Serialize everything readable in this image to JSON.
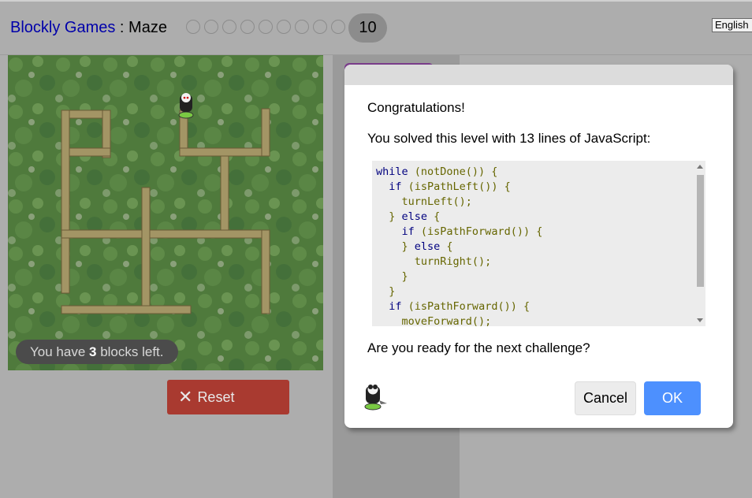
{
  "header": {
    "brand": "Blockly Games",
    "separator": " : ",
    "app": "Maze",
    "level_count": 9,
    "current_level": "10",
    "language": "English"
  },
  "maze": {
    "capacity_prefix": "You have ",
    "capacity_count": "3",
    "capacity_suffix": " blocks left.",
    "reset_label": "Reset",
    "background_color": "#4f7a3c",
    "wall_color": "#9b8a5a"
  },
  "dialog": {
    "heading": "Congratulations!",
    "solved_text": "You solved this level with 13 lines of JavaScript:",
    "code_lines": [
      "while (notDone()) {",
      "  if (isPathLeft()) {",
      "    turnLeft();",
      "  } else {",
      "    if (isPathForward()) {",
      "    } else {",
      "      turnRight();",
      "    }",
      "  }",
      "  if (isPathForward()) {",
      "    moveForward();"
    ],
    "question": "Are you ready for the next challenge?",
    "cancel_label": "Cancel",
    "ok_label": "OK",
    "ok_color": "#4d90fe"
  },
  "icons": {
    "reset": "close-x-icon",
    "avatar": "pegman-icon"
  }
}
